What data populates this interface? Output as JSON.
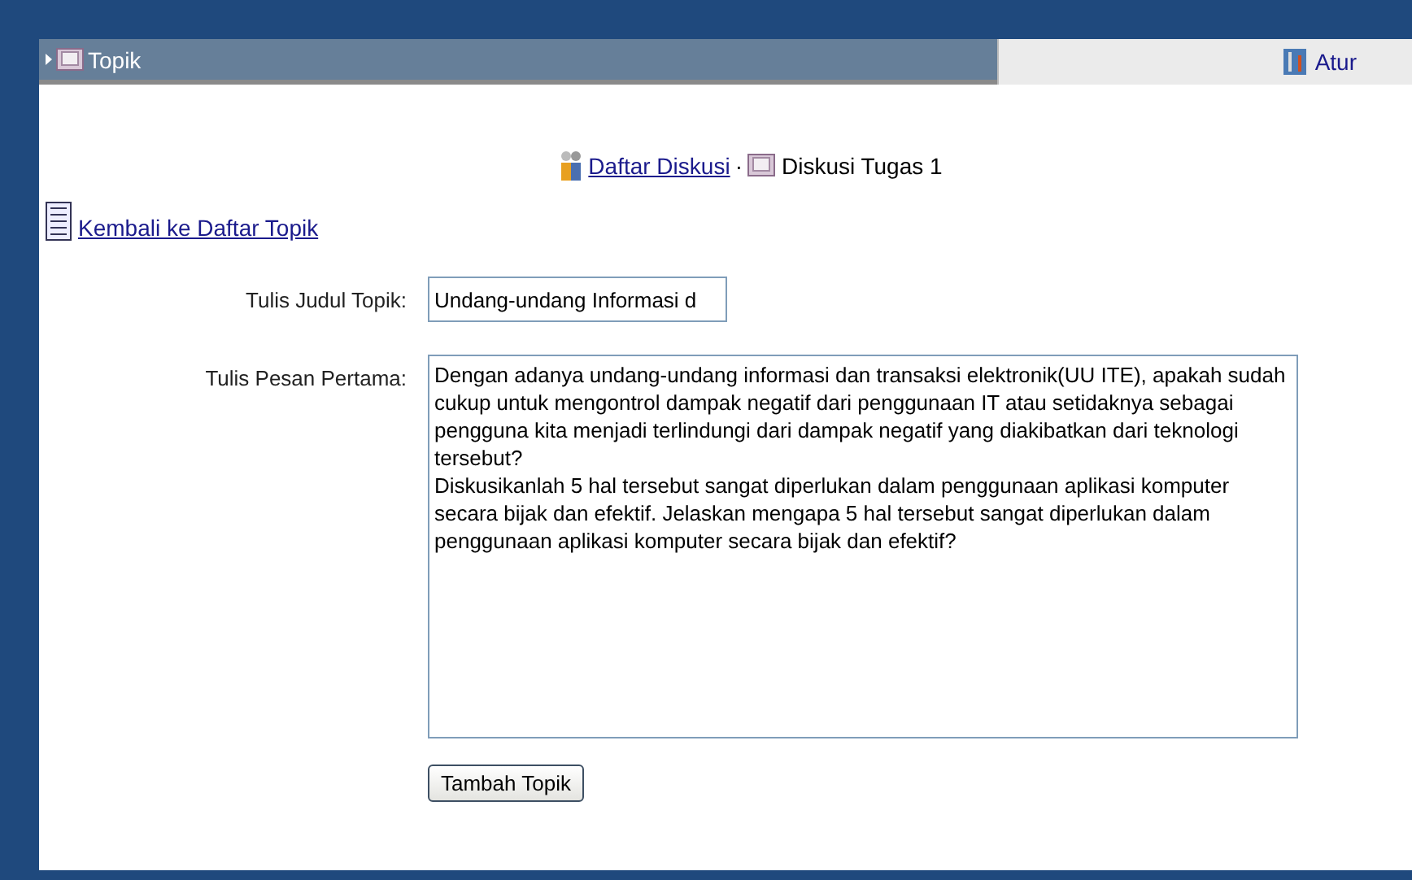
{
  "header": {
    "title": "Topik",
    "settings_link": "Atur"
  },
  "breadcrumb": {
    "link": "Daftar Diskusi",
    "separator": "·",
    "current": "Diskusi Tugas 1"
  },
  "back_link": "Kembali ke Daftar Topik",
  "form": {
    "title_label": "Tulis Judul Topik:",
    "title_value": "Undang-undang Informasi d",
    "message_label": "Tulis Pesan Pertama:",
    "message_value": "Dengan adanya undang-undang informasi dan transaksi elektronik(UU ITE), apakah sudah cukup untuk mengontrol dampak negatif dari penggunaan IT atau setidaknya sebagai pengguna kita menjadi terlindungi dari dampak negatif yang diakibatkan dari teknologi tersebut?\nDiskusikanlah 5 hal tersebut sangat diperlukan dalam penggunaan aplikasi komputer secara bijak dan efektif. Jelaskan mengapa 5 hal tersebut sangat diperlukan dalam penggunaan aplikasi komputer secara bijak dan efektif?",
    "submit": "Tambah Topik"
  }
}
